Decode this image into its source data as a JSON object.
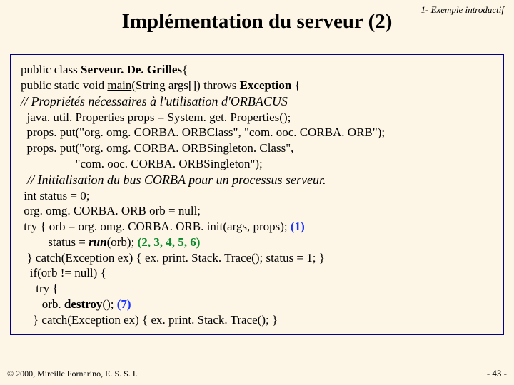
{
  "header_label": "1- Exemple introductif",
  "title": "Implémentation du serveur (2)",
  "code": {
    "l1a": "public class ",
    "l1b": "Serveur. De. Grilles",
    "l1c": "{",
    "l2a": "public static void ",
    "l2b": "main",
    "l2c": "(String args[]) throws ",
    "l2d": "Exception",
    "l2e": " {",
    "l3": "// Propriétés nécessaires à l'utilisation d'ORBACUS",
    "l4": "  java. util. Properties props = System. get. Properties();",
    "l5": "  props. put(\"org. omg. CORBA. ORBClass\", \"com. ooc. CORBA. ORB\");",
    "l6": "  props. put(\"org. omg. CORBA. ORBSingleton. Class\",",
    "l7": "                  \"com. ooc. CORBA. ORBSingleton\");",
    "l8": "  // Initialisation du bus CORBA pour un processus serveur.",
    "l9": " int status = 0;",
    "l10": " org. omg. CORBA. ORB orb = null;",
    "l11a": " try { orb = org. omg. CORBA. ORB. init(args, props); ",
    "l11b": "(1)",
    "l12a": "         status = ",
    "l12b": "run",
    "l12c": "(orb); ",
    "l12d": "(2, 3, 4, 5, 6)",
    "l13": "  } catch(Exception ex) { ex. print. Stack. Trace(); status = 1; }",
    "l14": "   if(orb != null) {",
    "l15": "     try {",
    "l16a": "       orb. ",
    "l16b": "destroy",
    "l16c": "(); ",
    "l16d": "(7)",
    "l17": "    } catch(Exception ex) { ex. print. Stack. Trace(); }"
  },
  "footer_left": "© 2000, Mireille Fornarino, E. S. S. I.",
  "footer_right": "- 43 -"
}
